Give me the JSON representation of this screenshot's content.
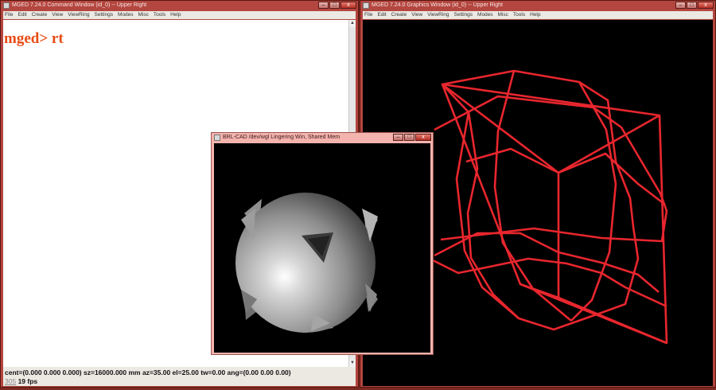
{
  "menu": [
    "File",
    "Edit",
    "Create",
    "View",
    "ViewRing",
    "Settings",
    "Modes",
    "Misc",
    "Tools",
    "Help"
  ],
  "command_window": {
    "title": "MGED 7.24.0 Command Window (id_0) -- Upper Right",
    "console_text": "mged> rt",
    "status_line": "cent=(0.000 0.000 0.000)  sz=16000.000  mm  az=35.00  el=25.00  tw=0.00  ang=(0.00 0.00 0.00)",
    "fps_prefix": "305",
    "fps_value": "19 fps"
  },
  "graphics_window": {
    "title": "MGED 7.24.0 Graphics Window (id_0) -- Upper Right",
    "wire_color": "#e8262e"
  },
  "raytrace_window": {
    "title": "BRL-CAD /dev/wgl Lingering Win, Shared Mem"
  },
  "window_buttons": {
    "minimize": "–",
    "maximize": "□",
    "close": "x"
  }
}
